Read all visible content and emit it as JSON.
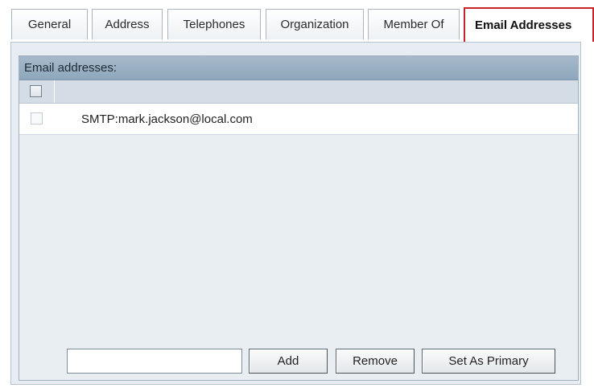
{
  "tabs": [
    {
      "label": "General",
      "active": false
    },
    {
      "label": "Address",
      "active": false
    },
    {
      "label": "Telephones",
      "active": false
    },
    {
      "label": "Organization",
      "active": false
    },
    {
      "label": "Member Of",
      "active": false
    },
    {
      "label": "Email Addresses",
      "active": true
    }
  ],
  "email_panel": {
    "header": "Email addresses:",
    "select_all_checked": false,
    "rows": [
      {
        "address": "SMTP:mark.jackson@local.com",
        "checked": false
      }
    ],
    "new_address_value": "",
    "buttons": {
      "add": "Add",
      "remove": "Remove",
      "set_primary": "Set As Primary"
    }
  },
  "colors": {
    "active_tab_border": "#c6232b",
    "header_bar": "#9fb3c6",
    "panel_background": "#e7edf2"
  }
}
